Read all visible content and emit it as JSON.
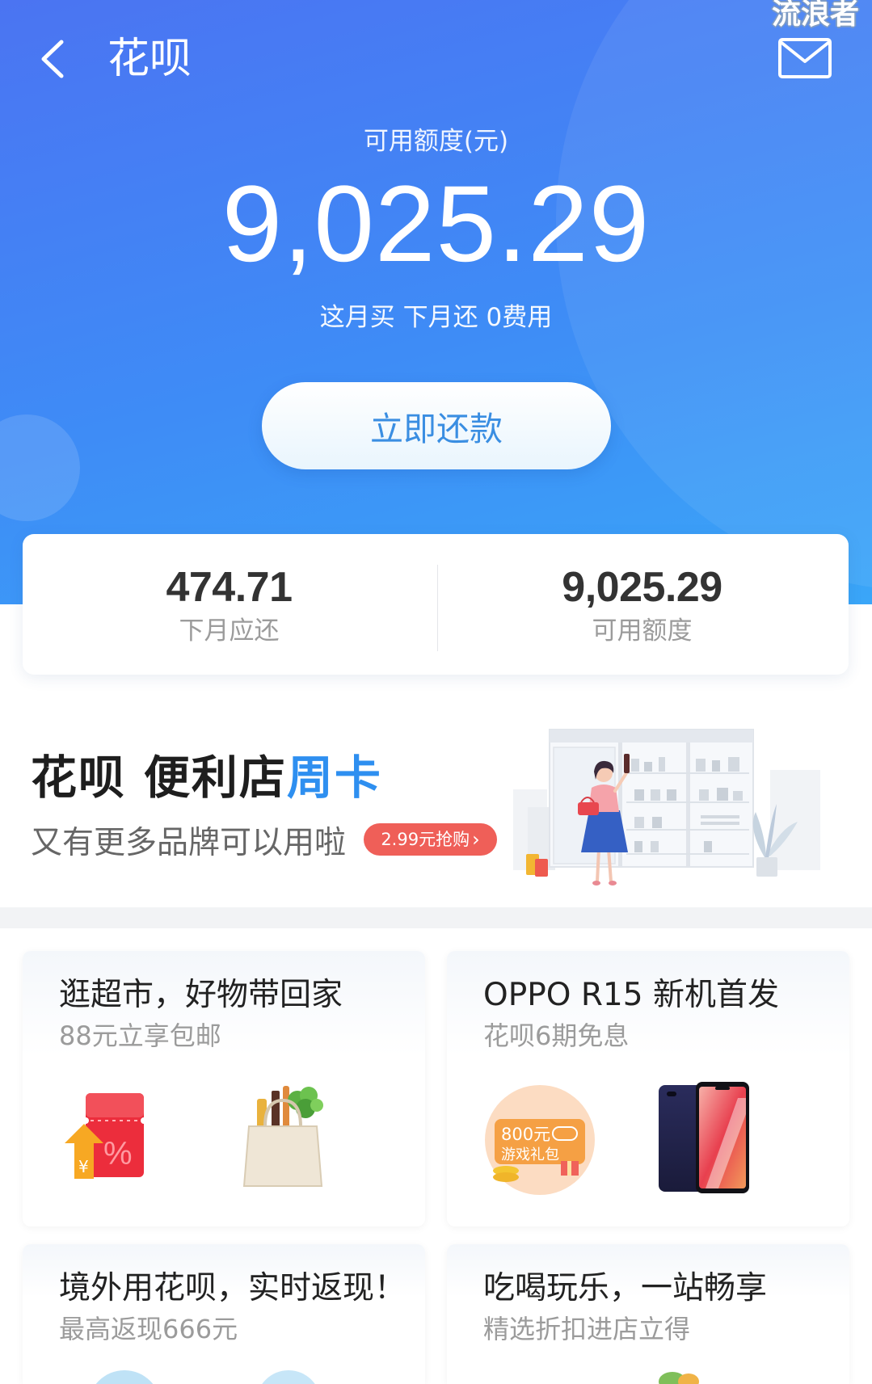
{
  "colors": {
    "hero_start": "#4b74f2",
    "hero_mid": "#3e8cf6",
    "hero_end": "#3aa6f8",
    "accent": "#2e8ff0",
    "badge": "#ef5f58",
    "text_dark": "#222222",
    "text_muted": "#9b9b9b"
  },
  "watermark": "流浪者",
  "header": {
    "title": "花呗",
    "back_icon": "chevron-left-icon",
    "mail_icon": "mail-icon"
  },
  "hero": {
    "label": "可用额度(元)",
    "amount": "9,025.29",
    "tagline": "这月买 下月还 0费用",
    "repay_button": "立即还款"
  },
  "summary": [
    {
      "value": "474.71",
      "label": "下月应还"
    },
    {
      "value": "9,025.29",
      "label": "可用额度"
    }
  ],
  "promo": {
    "title_main": "花呗 便利店",
    "title_accent": "周卡",
    "subtitle": "又有更多品牌可以用啦",
    "badge": "2.99元抢购",
    "badge_icon": "chevron-right-icon",
    "illustration": "convenience-store-illustration"
  },
  "offers": [
    {
      "title": "逛超市，好物带回家",
      "subtitle": "88元立享包邮",
      "images": [
        "coupon-icon",
        "grocery-bag-icon"
      ],
      "art": {
        "coupon_symbol": "%",
        "currency_symbol": "¥"
      }
    },
    {
      "title": "OPPO R15 新机首发",
      "subtitle": "花呗6期免息",
      "images": [
        "game-gift-icon",
        "phone-icon"
      ],
      "art": {
        "gift_amount": "800元",
        "gift_label": "游戏礼包"
      }
    },
    {
      "title": "境外用花呗，实时返现！",
      "subtitle": "最高返现666元"
    },
    {
      "title": "吃喝玩乐，一站畅享",
      "subtitle": "精选折扣进店立得"
    }
  ]
}
